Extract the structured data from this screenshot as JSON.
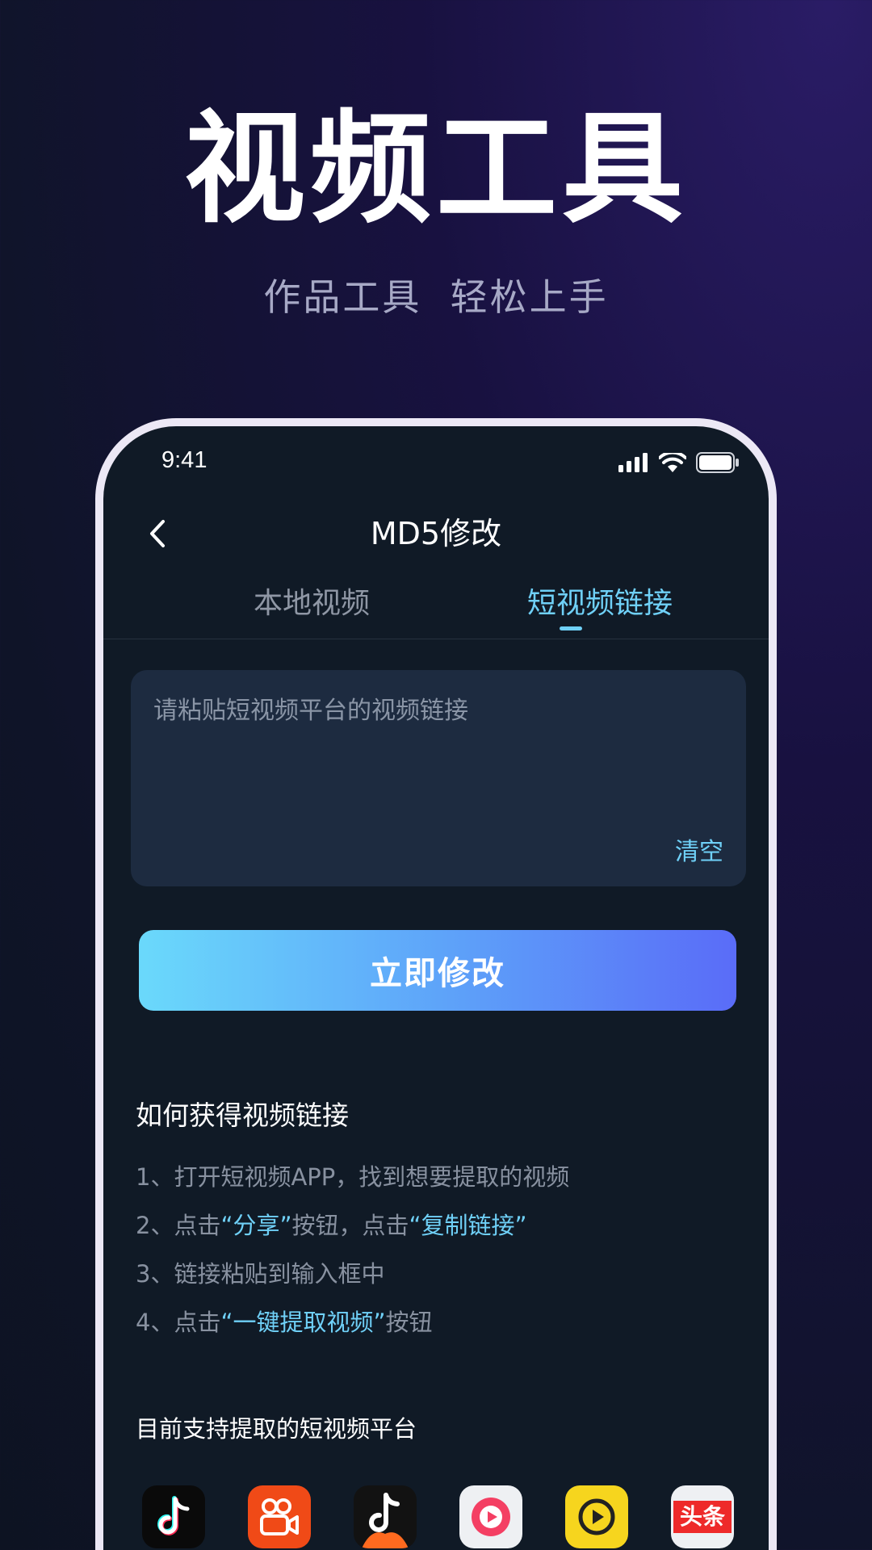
{
  "hero": {
    "title": "视频工具",
    "subtitle": "作品工具  轻松上手"
  },
  "status_bar": {
    "time": "9:41",
    "icons": [
      "cellular-signal-icon",
      "wifi-icon",
      "battery-icon"
    ]
  },
  "nav": {
    "title": "MD5修改",
    "back_icon": "chevron-left-icon"
  },
  "tabs": {
    "items": [
      {
        "label": "本地视频",
        "active": false
      },
      {
        "label": "短视频链接",
        "active": true
      }
    ]
  },
  "link_input": {
    "placeholder": "请粘贴短视频平台的视频链接",
    "value": "",
    "clear_label": "清空"
  },
  "submit_label": "立即修改",
  "howto": {
    "title": "如何获得视频链接",
    "steps": [
      {
        "prefix": "1、打开短视频APP，找到想要提取的视频"
      },
      {
        "prefix": "2、点击",
        "highlight1": "“分享”",
        "middle": "按钮，点击",
        "highlight2": "“复制链接”"
      },
      {
        "prefix": "3、链接粘贴到输入框中"
      },
      {
        "prefix": "4、点击",
        "highlight1": "“一键提取视频”",
        "suffix": "按钮"
      }
    ]
  },
  "platforms": {
    "title": "目前支持提取的短视频平台",
    "items": [
      {
        "icon": "douyin-icon",
        "bg": "#0a0a0a"
      },
      {
        "icon": "kuaishou-icon",
        "bg": "#f04a17"
      },
      {
        "icon": "douyin-volcano-icon",
        "bg": "#121212"
      },
      {
        "icon": "play-circle-red-icon",
        "bg": "#eef0f3"
      },
      {
        "icon": "play-circle-yellow-icon",
        "bg": "#f6d51e"
      },
      {
        "icon": "toutiao-icon",
        "bg": "#ee2a2a",
        "text": "头条"
      }
    ]
  },
  "colors": {
    "accent": "#6fd0f7",
    "button_gradient_start": "#6ad9fb",
    "button_gradient_end": "#5a6cf8",
    "screen_bg": "#101a26",
    "input_bg": "#1d2b40"
  }
}
